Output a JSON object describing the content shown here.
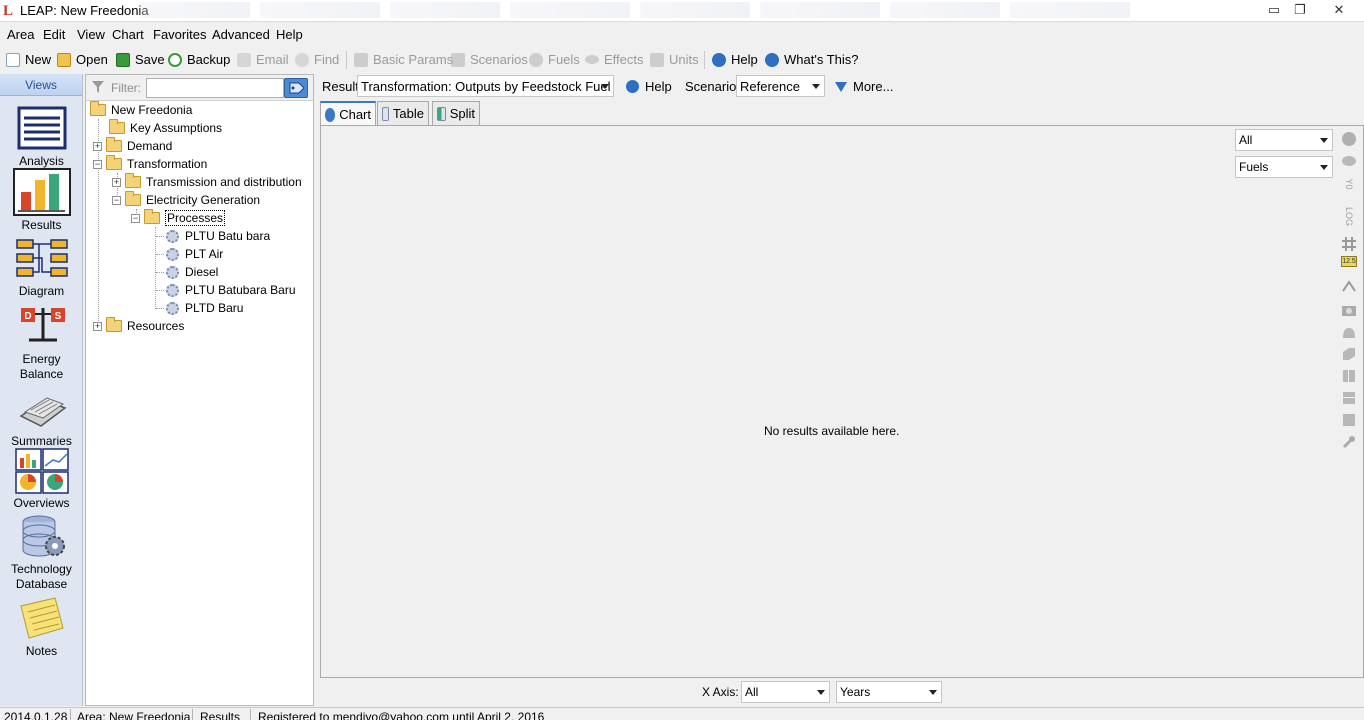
{
  "window": {
    "title": "LEAP: New Freedonia",
    "logo_letter": "L",
    "controls": {
      "minimize": "▭",
      "restore": "❐",
      "close": "✕"
    }
  },
  "menu": [
    "Area",
    "Edit",
    "View",
    "Chart",
    "Favorites",
    "Advanced",
    "Help"
  ],
  "toolbar": {
    "new": "New",
    "open": "Open",
    "save": "Save",
    "backup": "Backup",
    "email": "Email",
    "find": "Find",
    "basic_params": "Basic Params",
    "scenarios": "Scenarios",
    "fuels": "Fuels",
    "effects": "Effects",
    "units": "Units",
    "help": "Help",
    "whats_this": "What's This?"
  },
  "views": {
    "header": "Views",
    "items": [
      {
        "label": "Analysis",
        "icon": "analysis-icon"
      },
      {
        "label": "Results",
        "icon": "results-icon"
      },
      {
        "label": "Diagram",
        "icon": "diagram-icon"
      },
      {
        "label": "Energy\nBalance",
        "icon": "energy-balance-icon"
      },
      {
        "label": "Summaries",
        "icon": "summaries-icon"
      },
      {
        "label": "Overviews",
        "icon": "overviews-icon"
      },
      {
        "label": "Technology\nDatabase",
        "icon": "technology-database-icon"
      },
      {
        "label": "Notes",
        "icon": "notes-icon"
      }
    ],
    "selected": "Results"
  },
  "filter": {
    "label": "Filter:",
    "value": ""
  },
  "tree": {
    "root": "New Freedonia",
    "key_assumptions": "Key Assumptions",
    "demand": "Demand",
    "transformation": "Transformation",
    "transmission": "Transmission and distribution",
    "electricity_generation": "Electricity Generation",
    "processes": "Processes",
    "process_items": [
      "PLTU Batu bara",
      "PLT Air",
      "Diesel",
      "PLTU Batubara Baru",
      "PLTD Baru"
    ],
    "resources": "Resources"
  },
  "resultbar": {
    "result_label": "Result:",
    "result_value": "Transformation: Outputs by Feedstock Fuel",
    "help": "Help",
    "scenario_label": "Scenario:",
    "scenario_value": "Reference",
    "more": "More..."
  },
  "tabs": [
    "Chart",
    "Table",
    "Split"
  ],
  "active_tab": "Chart",
  "chart_panel": {
    "message": "No results available here.",
    "filter1": "All",
    "filter2": "Fuels",
    "side_icons": [
      "pie-chart-icon",
      "pie-3d-icon",
      "y0-label",
      "log-label",
      "grid-icon",
      "data-label-icon",
      "legend-icon",
      "camera-icon",
      "shape-icon-1",
      "shape-icon-2",
      "shape-icon-3",
      "shape-icon-4",
      "shape-icon-5",
      "wrench-icon"
    ],
    "y0_text": "Y0",
    "log_text": "LOG",
    "num_text": "12.5"
  },
  "xaxis": {
    "label": "X Axis:",
    "filter": "All",
    "units": "Years"
  },
  "status": {
    "version": "2014.0.1.28",
    "area": "Area: New Freedonia",
    "view": "Results",
    "registered": "Registered to mendiyo@yahoo.com until April 2, 2016"
  },
  "colors": {
    "accent": "#3a78c8",
    "views_bg": "#dfe6f2",
    "folder": "#f4d27a"
  }
}
